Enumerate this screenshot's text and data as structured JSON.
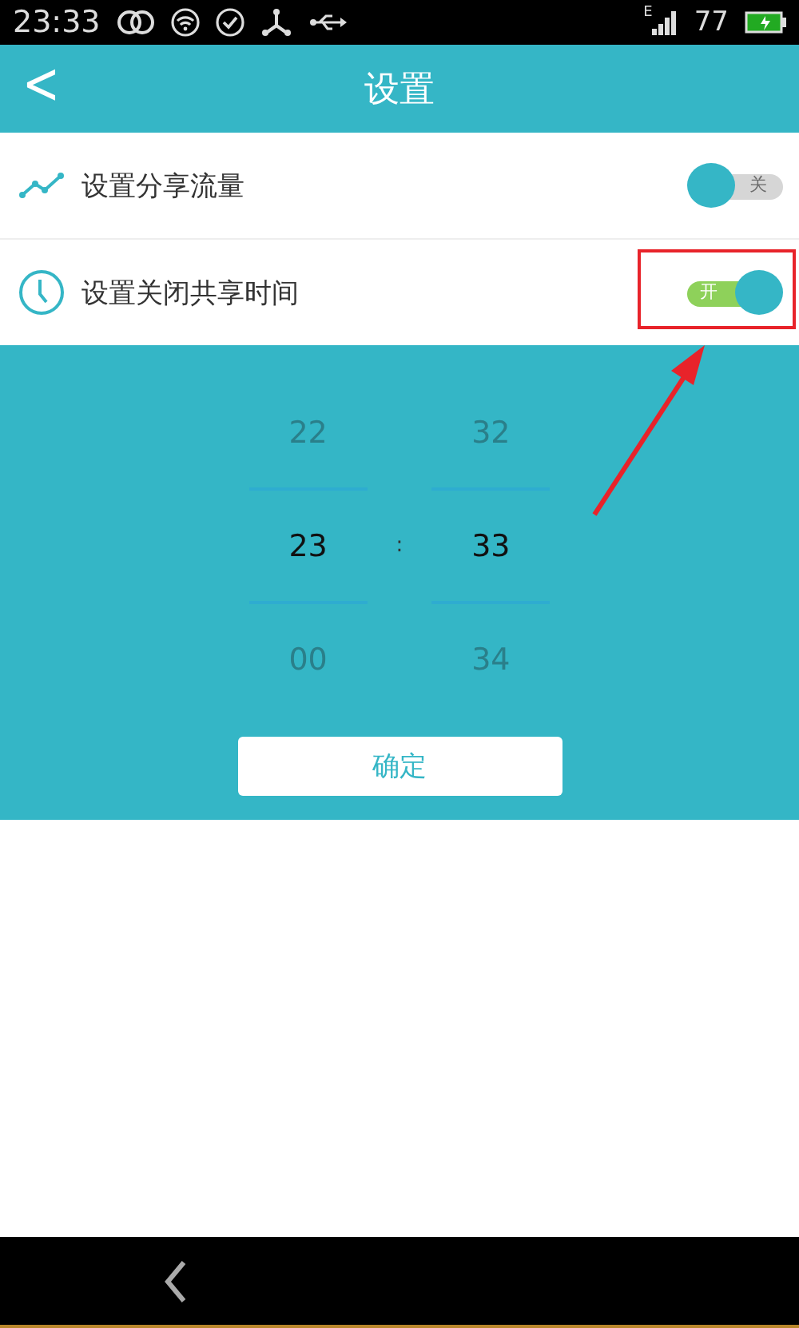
{
  "status_bar": {
    "time": "23:33",
    "network_type": "E",
    "battery_text": "77"
  },
  "header": {
    "title": "设置",
    "back": "<"
  },
  "settings": [
    {
      "label": "设置分享流量",
      "kind": "traffic",
      "on": false,
      "switch_text": "关",
      "highlighted": false
    },
    {
      "label": "设置关闭共享时间",
      "kind": "clock",
      "on": true,
      "switch_text": "开",
      "highlighted": true
    }
  ],
  "time_picker": {
    "separator": ":",
    "columns": [
      {
        "items": [
          {
            "text": "22",
            "selected": false
          },
          {
            "text": "23",
            "selected": true
          },
          {
            "text": "00",
            "selected": false
          }
        ]
      },
      {
        "items": [
          {
            "text": "32",
            "selected": false
          },
          {
            "text": "33",
            "selected": true
          },
          {
            "text": "34",
            "selected": false
          }
        ]
      }
    ],
    "confirm": "确定"
  }
}
